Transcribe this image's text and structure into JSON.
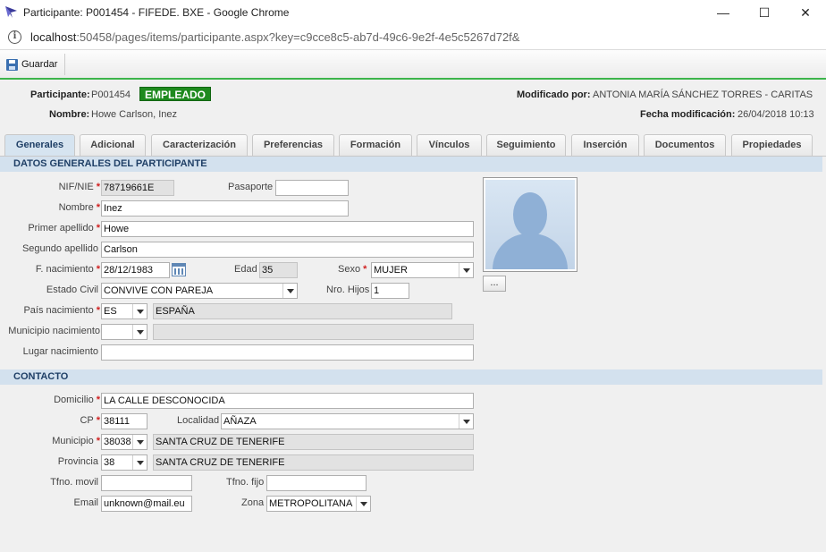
{
  "window": {
    "title": "Participante: P001454 - FIFEDE. BXE - Google Chrome",
    "url_host": "localhost",
    "url_rest": ":50458/pages/items/participante.aspx?key=c9cce8c5-ab7d-49c6-9e2f-4e5c5267d72f&",
    "minimize": "—",
    "maximize": "☐",
    "close": "✕",
    "info_glyph": "i"
  },
  "toolbar": {
    "save_label": "Guardar"
  },
  "header": {
    "participante_label": "Participante:",
    "participante_value": "P001454",
    "status_badge": "EMPLEADO",
    "nombre_label": "Nombre:",
    "nombre_value": "Howe Carlson, Inez",
    "modificado_label": "Modificado por:",
    "modificado_value": "ANTONIA MARÍA SÁNCHEZ TORRES - CARITAS",
    "fecha_label": "Fecha modificación:",
    "fecha_value": "26/04/2018 10:13"
  },
  "tabs": [
    "Generales",
    "Adicional",
    "Caracterización",
    "Preferencias",
    "Formación",
    "Vínculos",
    "Seguimiento",
    "Inserción",
    "Documentos",
    "Propiedades"
  ],
  "sections": {
    "datos_generales": "DATOS GENERALES DEL PARTICIPANTE",
    "contacto": "CONTACTO"
  },
  "fields": {
    "nif_label": "NIF/NIE",
    "nif": "78719661E",
    "pasaporte_label": "Pasaporte",
    "pasaporte": "",
    "nombre_label": "Nombre",
    "nombre": "Inez",
    "primer_apellido_label": "Primer apellido",
    "primer_apellido": "Howe",
    "segundo_apellido_label": "Segundo apellido",
    "segundo_apellido": "Carlson",
    "f_nacimiento_label": "F. nacimiento",
    "f_nacimiento": "28/12/1983",
    "edad_label": "Edad",
    "edad": "35",
    "sexo_label": "Sexo",
    "sexo": "MUJER",
    "estado_civil_label": "Estado Civil",
    "estado_civil": "CONVIVE CON PAREJA",
    "nro_hijos_label": "Nro. Hijos",
    "nro_hijos": "1",
    "pais_nacimiento_label": "País nacimiento",
    "pais_nacimiento_code": "ES",
    "pais_nacimiento_name": "ESPAÑA",
    "municipio_nacimiento_label": "Municipio nacimiento",
    "municipio_nacimiento_code": "",
    "municipio_nacimiento_name": "",
    "lugar_nacimiento_label": "Lugar nacimiento",
    "lugar_nacimiento": "",
    "domicilio_label": "Domicilio",
    "domicilio": "LA CALLE DESCONOCIDA",
    "cp_label": "CP",
    "cp": "38111",
    "localidad_label": "Localidad",
    "localidad": "AÑAZA",
    "municipio_label": "Municipio",
    "municipio_code": "38038",
    "municipio_name": "SANTA CRUZ DE TENERIFE",
    "provincia_label": "Provincia",
    "provincia_code": "38",
    "provincia_name": "SANTA CRUZ DE TENERIFE",
    "tfno_movil_label": "Tfno. movil",
    "tfno_movil": "",
    "tfno_fijo_label": "Tfno. fijo",
    "tfno_fijo": "",
    "email_label": "Email",
    "email": "unknown@mail.eu",
    "zona_label": "Zona",
    "zona": "METROPOLITANA"
  },
  "required_marker": "*",
  "photo_button": "...",
  "icons": {
    "logo": "app-logo-icon",
    "save": "floppy-disk-icon",
    "calendar": "calendar-icon",
    "photo": "avatar-placeholder-icon",
    "info": "info-icon"
  },
  "colors": {
    "accent": "#3cb44b",
    "badge": "#1e8a1e",
    "section_bg": "#d3e1ee",
    "required": "#d02020"
  }
}
